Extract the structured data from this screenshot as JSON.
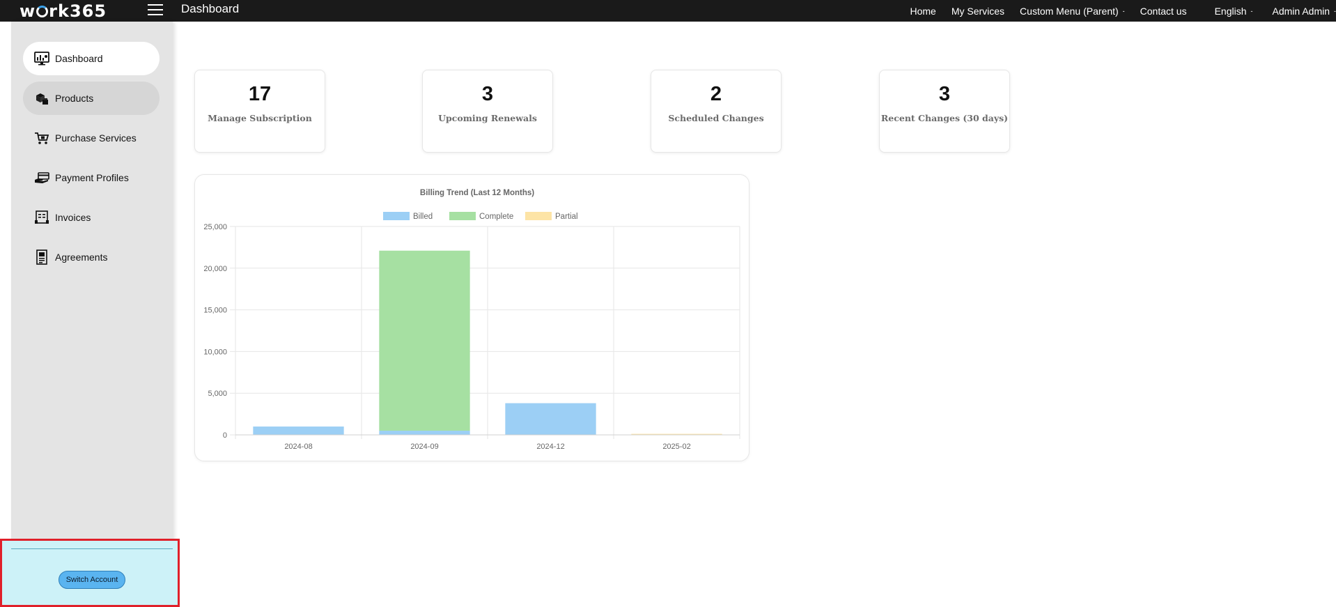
{
  "header": {
    "logo_text_left": "w",
    "logo_text_right": "rk365",
    "page_title": "Dashboard",
    "nav": [
      {
        "label": "Home",
        "has_dropdown": false
      },
      {
        "label": "My Services",
        "has_dropdown": false
      },
      {
        "label": "Custom Menu (Parent)",
        "has_dropdown": true
      },
      {
        "label": "Contact us",
        "has_dropdown": false
      },
      {
        "label": "English",
        "has_dropdown": true
      },
      {
        "label": "Admin Admin",
        "has_dropdown": true
      }
    ]
  },
  "sidebar": {
    "items": [
      {
        "label": "Dashboard",
        "icon": "dashboard-monitor-icon",
        "state": "active"
      },
      {
        "label": "Products",
        "icon": "products-boxes-icon",
        "state": "hover"
      },
      {
        "label": "Purchase Services",
        "icon": "shopping-cart-icon",
        "state": ""
      },
      {
        "label": "Payment Profiles",
        "icon": "hand-card-icon",
        "state": ""
      },
      {
        "label": "Invoices",
        "icon": "invoice-icon",
        "state": ""
      },
      {
        "label": "Agreements",
        "icon": "agreement-document-icon",
        "state": ""
      }
    ],
    "switch_account_label": "Switch Account"
  },
  "stats": [
    {
      "value": "17",
      "label": "Manage Subscription"
    },
    {
      "value": "3",
      "label": "Upcoming Renewals"
    },
    {
      "value": "2",
      "label": "Scheduled Changes"
    },
    {
      "value": "3",
      "label": "Recent Changes (30 days)"
    }
  ],
  "colors": {
    "billed": "#9ccff5",
    "complete": "#a6e0a2",
    "partial": "#fde4a6",
    "topbar": "#1a1a1a",
    "sidebar": "#e4e4e4",
    "highlight_border": "#e0202a"
  },
  "chart_data": {
    "type": "bar",
    "stacked": true,
    "title": "Billing Trend (Last 12 Months)",
    "legend_position": "top",
    "grid": true,
    "categories": [
      "2024-08",
      "2024-09",
      "2024-12",
      "2025-02"
    ],
    "series": [
      {
        "name": "Billed",
        "color": "#9ccff5",
        "values": [
          1000,
          500,
          3800,
          0
        ]
      },
      {
        "name": "Complete",
        "color": "#a6e0a2",
        "values": [
          0,
          21600,
          0,
          0
        ]
      },
      {
        "name": "Partial",
        "color": "#fde4a6",
        "values": [
          0,
          0,
          0,
          120
        ]
      }
    ],
    "ylim": [
      0,
      25000
    ],
    "yticks": [
      0,
      5000,
      10000,
      15000,
      20000,
      25000
    ],
    "ytick_labels": [
      "0",
      "5,000",
      "10,000",
      "15,000",
      "20,000",
      "25,000"
    ]
  }
}
